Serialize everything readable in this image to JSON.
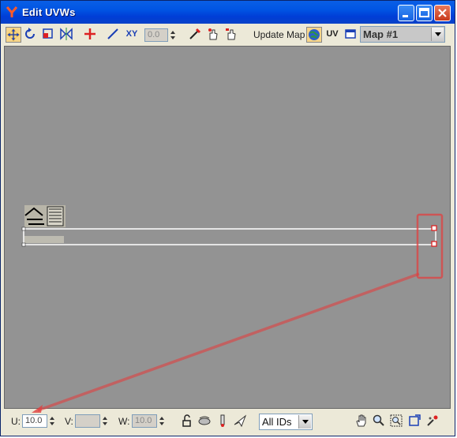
{
  "window": {
    "title": "Edit UVWs"
  },
  "toolbar": {
    "rotate_value": "0.0",
    "update_map_label": "Update Map",
    "uv_label": "UV",
    "xy_label": "XY",
    "map_select": "Map #1"
  },
  "bottom": {
    "u_label": "U:",
    "u_value": "10.0",
    "v_label": "V:",
    "v_value": "",
    "w_label": "W:",
    "w_value": "10.0",
    "id_filter": "All IDs"
  },
  "colors": {
    "viewport_bg": "#939393",
    "highlight": "#e04040",
    "title_bar": "#0054e3"
  }
}
